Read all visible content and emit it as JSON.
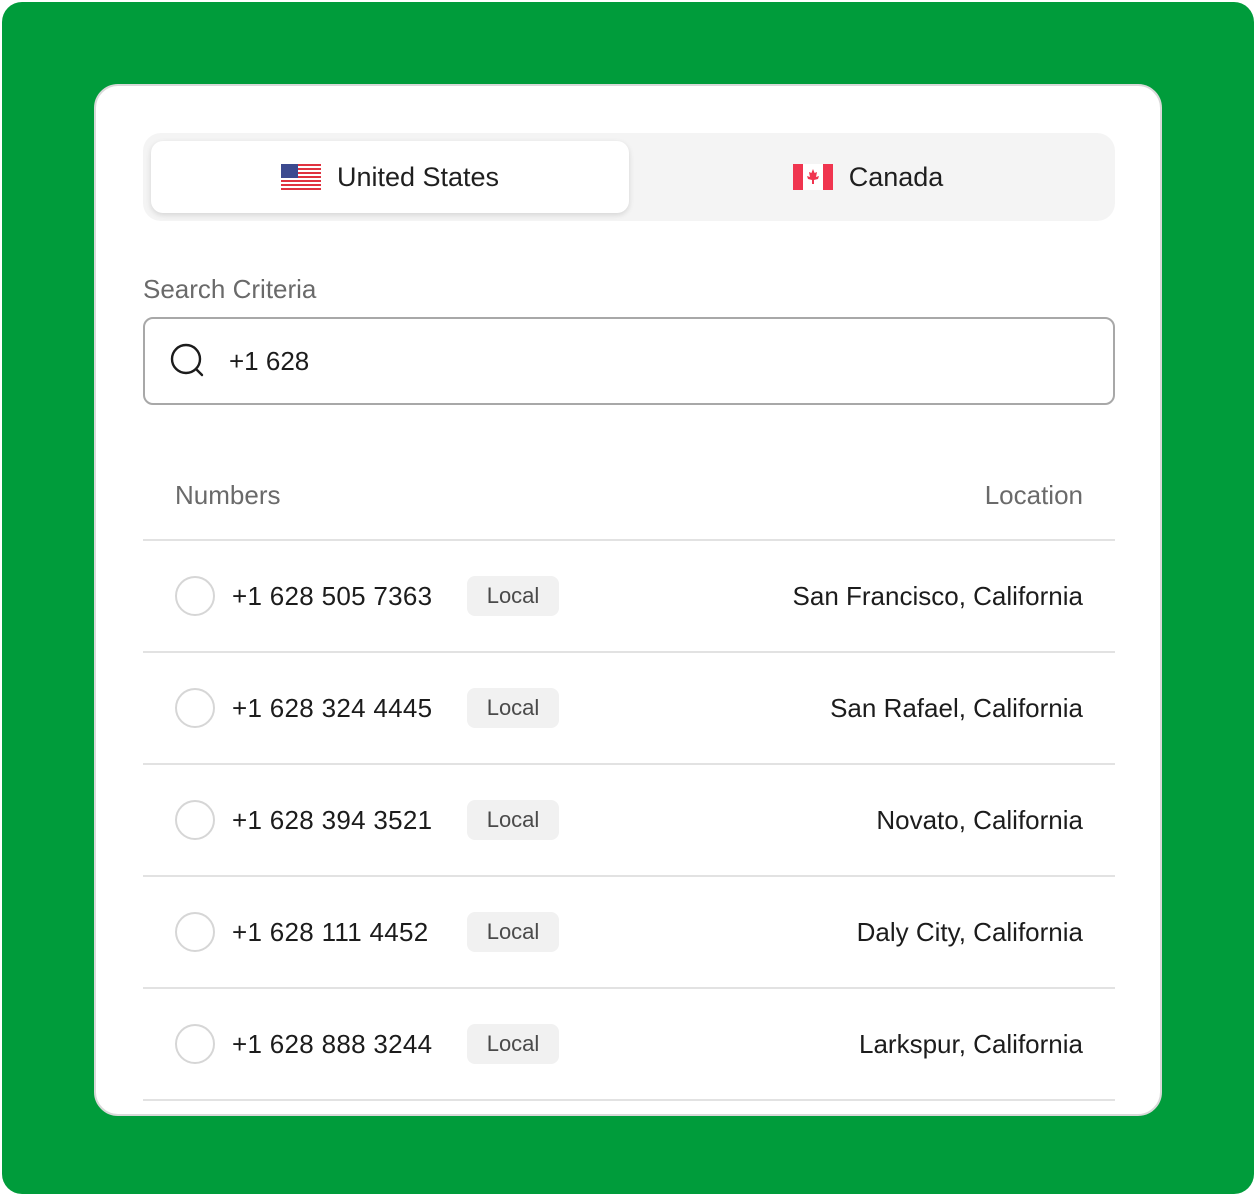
{
  "colors": {
    "background_green": "#009c3b",
    "card_background": "#ffffff",
    "toggle_background": "#f4f4f4",
    "badge_background": "#f1f1f1",
    "text_primary": "#1c1c1c",
    "text_muted": "#6a6a6a"
  },
  "country_toggle": {
    "selected": "United States",
    "tabs": [
      {
        "label": "United States",
        "icon": "us-flag-icon",
        "active": true
      },
      {
        "label": "Canada",
        "icon": "canada-flag-icon",
        "active": false
      }
    ]
  },
  "search": {
    "label": "Search Criteria",
    "value": "+1 628",
    "icon": "search-icon"
  },
  "table": {
    "columns": [
      "Numbers",
      "Location"
    ],
    "rows": [
      {
        "number": "+1 628 505 7363",
        "type": "Local",
        "location": "San Francisco, California",
        "selected": false
      },
      {
        "number": "+1 628 324 4445",
        "type": "Local",
        "location": "San Rafael, California",
        "selected": false
      },
      {
        "number": "+1 628 394 3521",
        "type": "Local",
        "location": "Novato, California",
        "selected": false
      },
      {
        "number": "+1 628 111 4452",
        "type": "Local",
        "location": "Daly City, California",
        "selected": false
      },
      {
        "number": "+1 628 888 3244",
        "type": "Local",
        "location": "Larkspur, California",
        "selected": false
      }
    ]
  }
}
